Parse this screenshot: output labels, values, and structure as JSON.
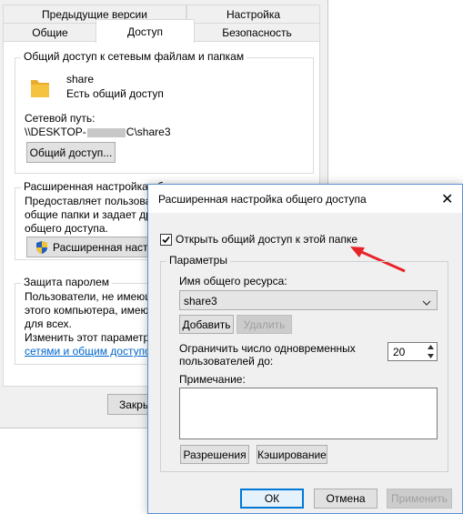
{
  "properties": {
    "tabs_row1": [
      "Предыдущие версии",
      "Настройка"
    ],
    "tabs_row2": [
      "Общие",
      "Доступ",
      "Безопасность"
    ],
    "network_group": {
      "title": "Общий доступ к сетевым файлам и папкам",
      "folder_name": "share",
      "folder_status": "Есть общий доступ",
      "path_label": "Сетевой путь:",
      "path_value": "\\\\DESKTOP-",
      "path_suffix": "C\\share3",
      "share_button": "Общий доступ..."
    },
    "advanced_group": {
      "title": "Расширенная настройка общего доступа",
      "desc_line1": "Предоставляет пользоват",
      "desc_line2": "общие папки и задает дру",
      "desc_line3": "общего доступа.",
      "button": "Расширенная настро"
    },
    "password_group": {
      "title": "Защита паролем",
      "line1": "Пользователи, не имеющи",
      "line2": "этого компьютера, имеют",
      "line3": "для всех.",
      "line4": "Изменить этот параметр м",
      "link": "сетями и общим доступом"
    },
    "close_button": "Закры"
  },
  "dialog": {
    "title": "Расширенная настройка общего доступа",
    "close_glyph": "✕",
    "share_checkbox_label": "Открыть общий доступ к этой папке",
    "share_checked": true,
    "params_group": {
      "title": "Параметры",
      "share_name_label": "Имя общего ресурса:",
      "share_name_value": "share3",
      "add_button": "Добавить",
      "remove_button": "Удалить",
      "limit_label_line1": "Ограничить число одновременных",
      "limit_label_line2": "пользователей до:",
      "limit_value": "20",
      "comment_label": "Примечание:",
      "comment_value": "",
      "permissions_button": "Разрешения",
      "caching_button": "Кэширование"
    },
    "ok_button": "ОК",
    "cancel_button": "Отмена",
    "apply_button": "Применить"
  },
  "colors": {
    "accent": "#0078d7",
    "arrow": "#e8232a",
    "folder": "#f5c340"
  }
}
